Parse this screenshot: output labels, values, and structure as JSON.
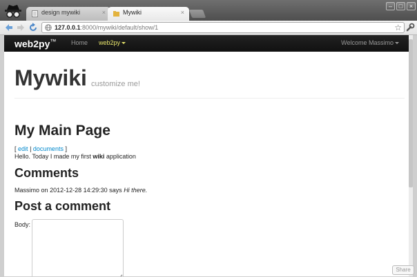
{
  "browser": {
    "tabs": [
      {
        "label": "design mywiki"
      },
      {
        "label": "Mywiki"
      }
    ],
    "close_glyph": "×",
    "url_host": "127.0.0.1",
    "url_rest": ":8000/mywiki/default/show/1",
    "star_glyph": "☆",
    "window_min": "–",
    "window_max": "□",
    "window_close": "×"
  },
  "navbar": {
    "brand": "web2py",
    "brand_tm": "™",
    "home": "Home",
    "web2py_menu": "web2py",
    "welcome": "Welcome Massimo"
  },
  "header": {
    "title": "Mywiki",
    "subtitle": "customize me!"
  },
  "page": {
    "heading": "My Main Page",
    "link_open": "[",
    "edit_link": "edit",
    "separator": "|",
    "documents_link": "documents",
    "link_close": "]",
    "body_before": "Hello. Today I made my first ",
    "body_bold": "wiki",
    "body_after": " application"
  },
  "comments": {
    "heading": "Comments",
    "author": "Massimo",
    "on_word": "on",
    "datetime": "2012-12-28 14:29:30",
    "says_word": "says",
    "text": "Hi there."
  },
  "post_comment": {
    "heading": "Post a comment",
    "body_label": "Body:",
    "body_value": ""
  },
  "share": {
    "label": "Share"
  },
  "colors": {
    "navbar": "#111111",
    "link": "#0088cc",
    "active_menu": "#e8e56b"
  },
  "icons": [
    "incognito-icon",
    "page-icon",
    "folder-icon",
    "back-arrow-icon",
    "forward-arrow-icon",
    "reload-icon",
    "globe-icon",
    "star-icon",
    "wrench-icon"
  ]
}
